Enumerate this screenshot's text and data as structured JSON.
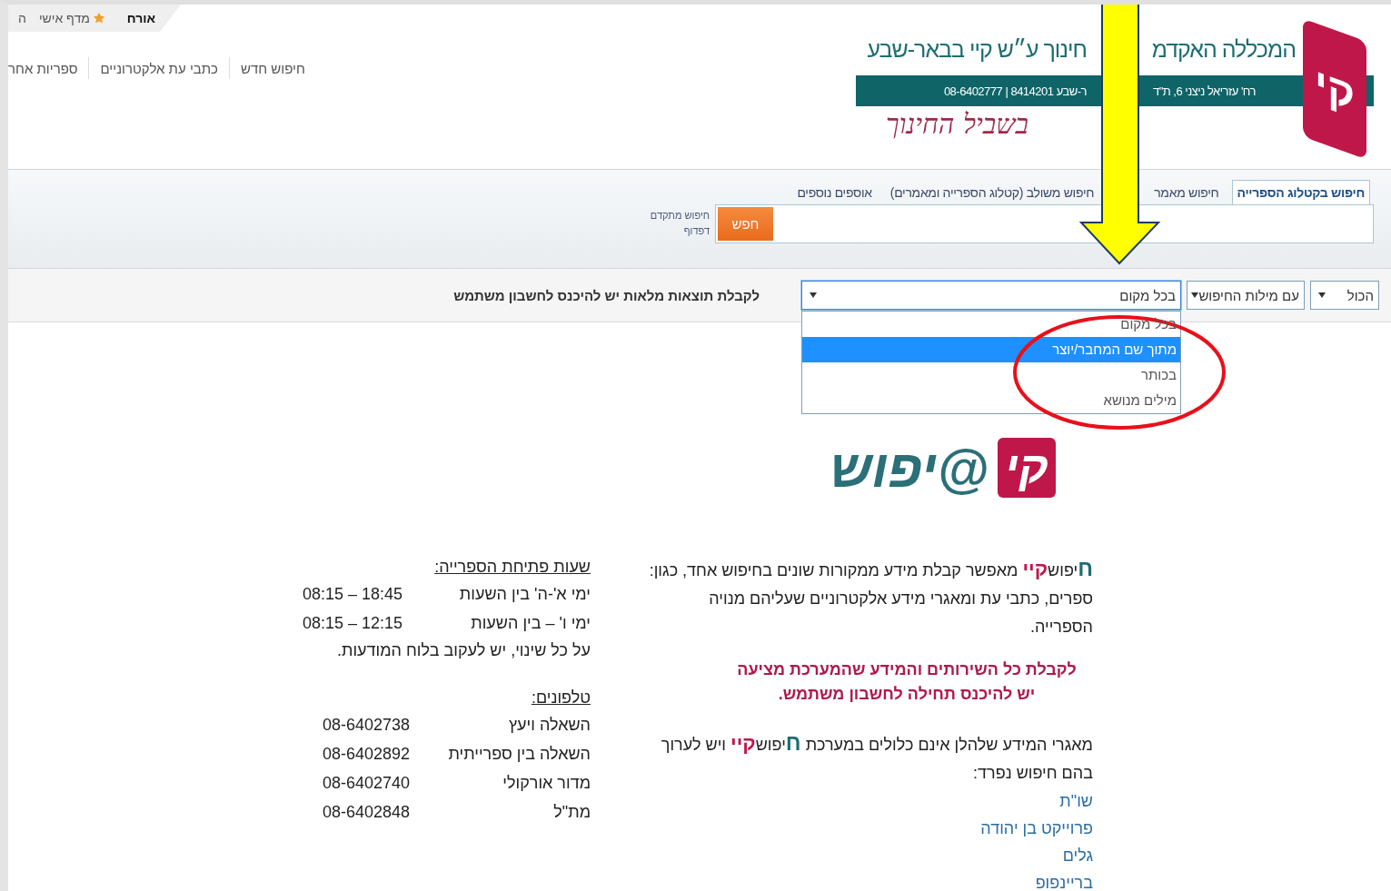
{
  "user_bar": {
    "items": [
      {
        "label": "אורח",
        "kind": "user"
      },
      {
        "label": "מדף אישי",
        "kind": "shelf"
      },
      {
        "label": "ה",
        "kind": "plain"
      }
    ]
  },
  "nav": [
    "חיפוש חדש",
    "כתבי עת אלקטרוניים",
    "ספריות אחר"
  ],
  "header": {
    "logo_mark": "קי",
    "title_parts": [
      "המכללה האקדמ",
      "חינוך ע״ש קיי בבאר-שבע"
    ],
    "address_parts": [
      "רח' עזריאל ניצני 6, ת\"ד",
      "ר-שבע 8414201 | 08-6402777"
    ],
    "slogan": "בשביל החינוך"
  },
  "search_tabs": [
    {
      "label": "חיפוש בקטלוג הספרייה",
      "selected": true
    },
    {
      "label": "חיפוש מאמר",
      "selected": false
    },
    {
      "label": "חיפוש משולב (קטלוג הספרייה ומאמרים)",
      "selected": false
    },
    {
      "label": "אוספים נוספים",
      "selected": false
    }
  ],
  "search": {
    "button": "חפש",
    "links": [
      "חיפוש מתקדם",
      "דפדוף"
    ]
  },
  "filters": {
    "selects": [
      {
        "value": "הכול",
        "open": false
      },
      {
        "value": "עם מילות החיפוש",
        "open": false
      },
      {
        "value": "בכל מקום",
        "open": true
      }
    ],
    "options": [
      {
        "label": "בכל מקום",
        "selected": false
      },
      {
        "label": "מתוך שם המחבר/יוצר",
        "selected": true
      },
      {
        "label": "בכותר",
        "selected": false
      },
      {
        "label": "מילים מנושא",
        "selected": false
      }
    ],
    "notice": "לקבלת תוצאות מלאות יש להיכנס לחשבון משתמש"
  },
  "logo": {
    "main": "@יפוש",
    "mark": "קי"
  },
  "about": {
    "intro": [
      {
        "kind": "h",
        "text": "ח"
      },
      {
        "kind": "plain",
        "text": "יפוש"
      },
      {
        "kind": "k",
        "text": "קיי"
      },
      {
        "kind": "plain",
        "text": " מאפשר קבלת מידע ממקורות שונים בחיפוש אחד, כגון: ספרים, כתבי עת ומאגרי מידע אלקטרוניים שעליהם מנויה הספרייה."
      }
    ],
    "notice_lines": [
      "לקבלת כל השירותים והמידע שהמערכת מציעה",
      "יש להיכנס תחילה לחשבון משתמש."
    ],
    "external": [
      {
        "kind": "plain",
        "text": "מאגרי המידע שלהלן אינם כלולים במערכת "
      },
      {
        "kind": "h",
        "text": "ח"
      },
      {
        "kind": "plain",
        "text": "יפוש"
      },
      {
        "kind": "k",
        "text": "קיי"
      },
      {
        "kind": "plain",
        "text": " ויש לערוך בהם חיפוש נפרד:"
      }
    ],
    "links": [
      "שו\"ת",
      "פרוייקט בן יהודה",
      "גלים",
      "בריינפופ"
    ]
  },
  "hours": {
    "title": "שעות פתיחת הספרייה:",
    "rows": [
      {
        "label": "ימי א'-ה' בין השעות",
        "value": "08:15 – 18:45"
      },
      {
        "label": "ימי ו' – בין השעות",
        "value": "08:15 – 12:15"
      }
    ],
    "note": "על כל שינוי, יש לעקוב בלוח המודעות."
  },
  "phones": {
    "title": "טלפונים:",
    "rows": [
      {
        "label": "השאלה ויעץ",
        "value": "08-6402738"
      },
      {
        "label": "השאלה בין ספרייתית",
        "value": "08-6402892"
      },
      {
        "label": "מדור אורקולי",
        "value": "08-6402740"
      },
      {
        "label": "מת\"ל",
        "value": "08-6402848"
      }
    ]
  }
}
